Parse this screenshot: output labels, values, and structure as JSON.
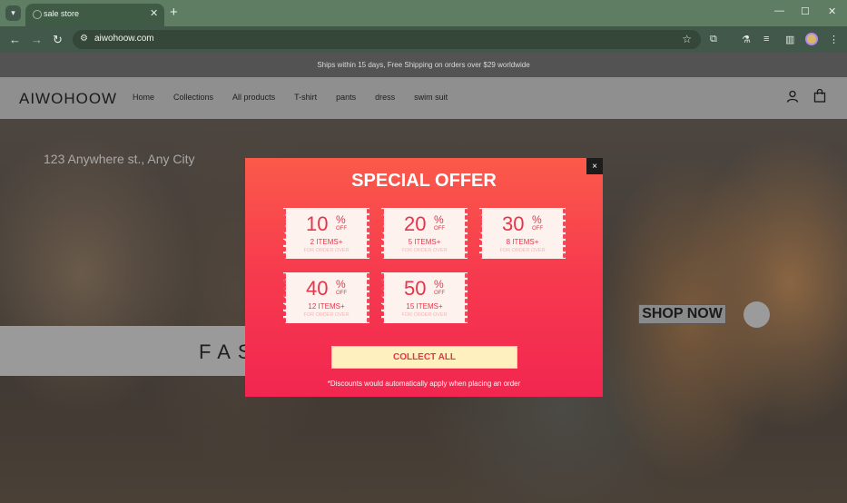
{
  "browser": {
    "tab_title": "sale store",
    "url": "aiwohoow.com"
  },
  "store": {
    "announcement": "Ships within 15 days, Free Shipping on orders over $29 worldwide",
    "logo": "AIWOHOOW",
    "nav": [
      "Home",
      "Collections",
      "All products",
      "T-shirt",
      "pants",
      "dress",
      "swim suit"
    ],
    "address": "123 Anywhere st., Any City",
    "hero_text": "FAS",
    "shop_now": "SHOP NOW"
  },
  "modal": {
    "title": "SPECIAL OFFER",
    "coupons": [
      {
        "percent": "10",
        "symbol": "%",
        "off": "OFF",
        "items": "2 ITEMS+",
        "sub": "FOR ORDER OVER"
      },
      {
        "percent": "20",
        "symbol": "%",
        "off": "OFF",
        "items": "5 ITEMS+",
        "sub": "FOR ORDER OVER"
      },
      {
        "percent": "30",
        "symbol": "%",
        "off": "OFF",
        "items": "8 ITEMS+",
        "sub": "FOR ORDER OVER"
      },
      {
        "percent": "40",
        "symbol": "%",
        "off": "OFF",
        "items": "12 ITEMS+",
        "sub": "FOR ORDER OVER"
      },
      {
        "percent": "50",
        "symbol": "%",
        "off": "OFF",
        "items": "15 ITEMS+",
        "sub": "FOR ORDER OVER"
      }
    ],
    "collect_label": "COLLECT ALL",
    "note": "*Discounts would automatically apply when placing an order",
    "close_glyph": "×"
  },
  "colors": {
    "tabbar": "#5f7d63",
    "toolbar": "#41584a",
    "modal_top": "#fb5a4a",
    "modal_bottom": "#f22650",
    "coupon_text": "#e8344a"
  }
}
